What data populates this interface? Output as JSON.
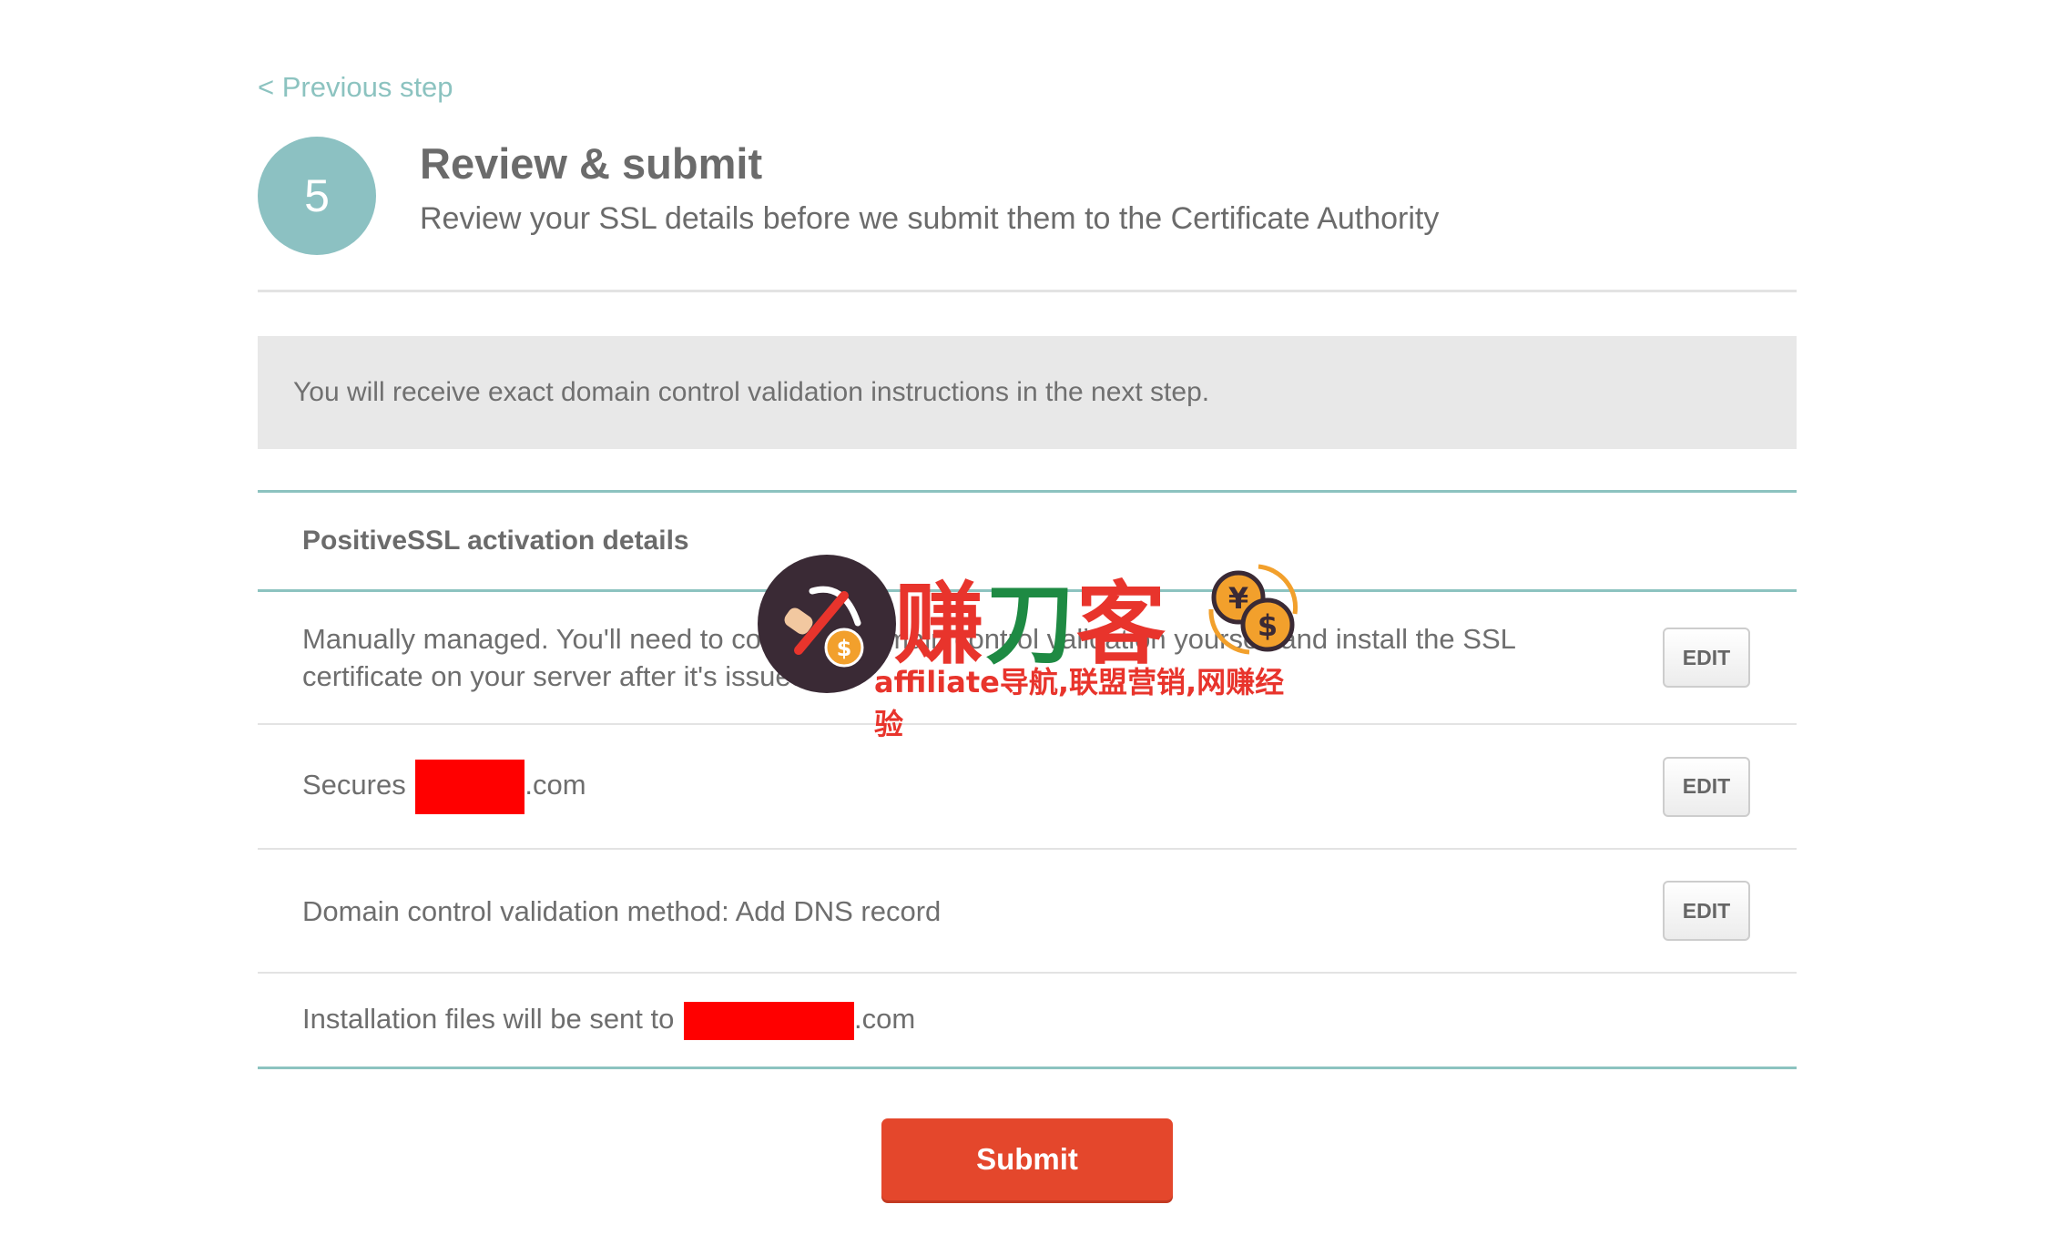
{
  "nav": {
    "previous_step": "< Previous step"
  },
  "step": {
    "number": "5",
    "title": "Review & submit",
    "subtitle": "Review your SSL details before we submit them to the Certificate Authority"
  },
  "notice": "You will receive exact domain control validation instructions in the next step.",
  "panel": {
    "heading": "PositiveSSL activation details",
    "rows": [
      {
        "text": "Manually managed. You'll need to complete domain control validation yourself and install the SSL certificate on your server after it's issued.",
        "edit_label": "EDIT"
      },
      {
        "prefix": "Secures ",
        "suffix": ".com",
        "edit_label": "EDIT"
      },
      {
        "text": "Domain control validation method: Add DNS record",
        "edit_label": "EDIT"
      },
      {
        "prefix": "Installation files will be sent to ",
        "suffix": ".com"
      }
    ]
  },
  "submit_label": "Submit",
  "watermark": {
    "cn_part1": "赚",
    "cn_part2": "刀",
    "cn_part3": "客",
    "sub": "affiliate导航,联盟营销,网赚经验"
  },
  "colors": {
    "accent": "#8cc3c0",
    "submit": "#e4472c",
    "redaction": "#ff0000"
  }
}
